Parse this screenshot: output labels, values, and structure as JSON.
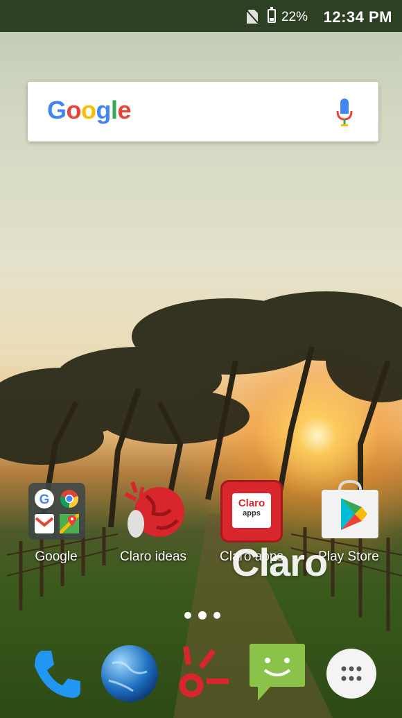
{
  "status_bar": {
    "battery_percent": "22%",
    "time": "12:34 PM",
    "icons": [
      "no-sim-icon",
      "battery-icon"
    ]
  },
  "search_widget": {
    "logo_text": [
      "G",
      "o",
      "o",
      "g",
      "l",
      "e"
    ],
    "logo_colors": [
      "#4285F4",
      "#EA4335",
      "#FBBC05",
      "#4285F4",
      "#34A853",
      "#EA4335"
    ],
    "icon": "mic-icon"
  },
  "home_apps": [
    {
      "label": "Google",
      "icon": "google-folder-icon"
    },
    {
      "label": "Claro ideas",
      "icon": "claro-ideas-icon"
    },
    {
      "label": "Claro apps",
      "icon": "claro-apps-icon"
    },
    {
      "label": "Play Store",
      "icon": "play-store-icon"
    }
  ],
  "claro_apps_badge": {
    "line1": "Claro",
    "line2": "apps"
  },
  "wallpaper_watermark": "Claro",
  "page_indicator": {
    "pages": 3,
    "current": 1
  },
  "dock": [
    {
      "icon": "phone-icon"
    },
    {
      "icon": "browser-globe-icon"
    },
    {
      "icon": "claro-logo-icon"
    },
    {
      "icon": "messaging-icon"
    },
    {
      "icon": "app-drawer-icon"
    }
  ],
  "colors": {
    "claro_red": "#D8262C",
    "play_blue": "#4285F4",
    "message_green": "#8BC34A",
    "phone_blue": "#2196F3"
  }
}
